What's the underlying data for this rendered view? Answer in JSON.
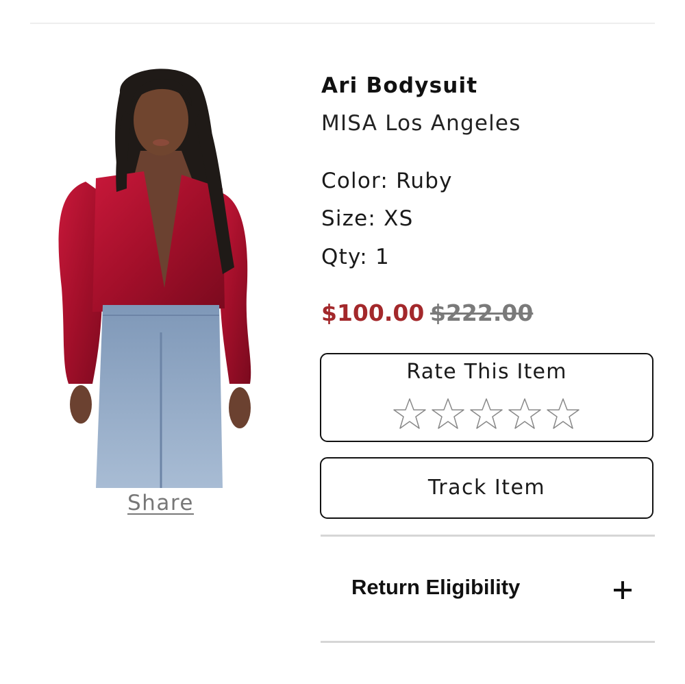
{
  "product": {
    "title": "Ari Bodysuit",
    "brand": "MISA Los Angeles",
    "color_line": "Color: Ruby",
    "size_line": "Size: XS",
    "qty_line": "Qty: 1",
    "price_sale": "$100.00",
    "price_original": "$222.00",
    "image_icon": "model-in-red-velvet-bodysuit-photo"
  },
  "share": {
    "label": "Share"
  },
  "rating": {
    "title": "Rate This Item",
    "max_stars": 5,
    "current_rating": 0,
    "star_icon": "star-outline-icon"
  },
  "track": {
    "label": "Track Item"
  },
  "returns": {
    "label": "Return Eligibility",
    "expand_icon": "plus-icon"
  },
  "colors": {
    "sale_price": "#a3282b",
    "original_price": "#7a7a7a",
    "border": "#111111",
    "divider": "#d6d6d6",
    "garment": "#b2122b",
    "denim": "#8fa7c4"
  }
}
